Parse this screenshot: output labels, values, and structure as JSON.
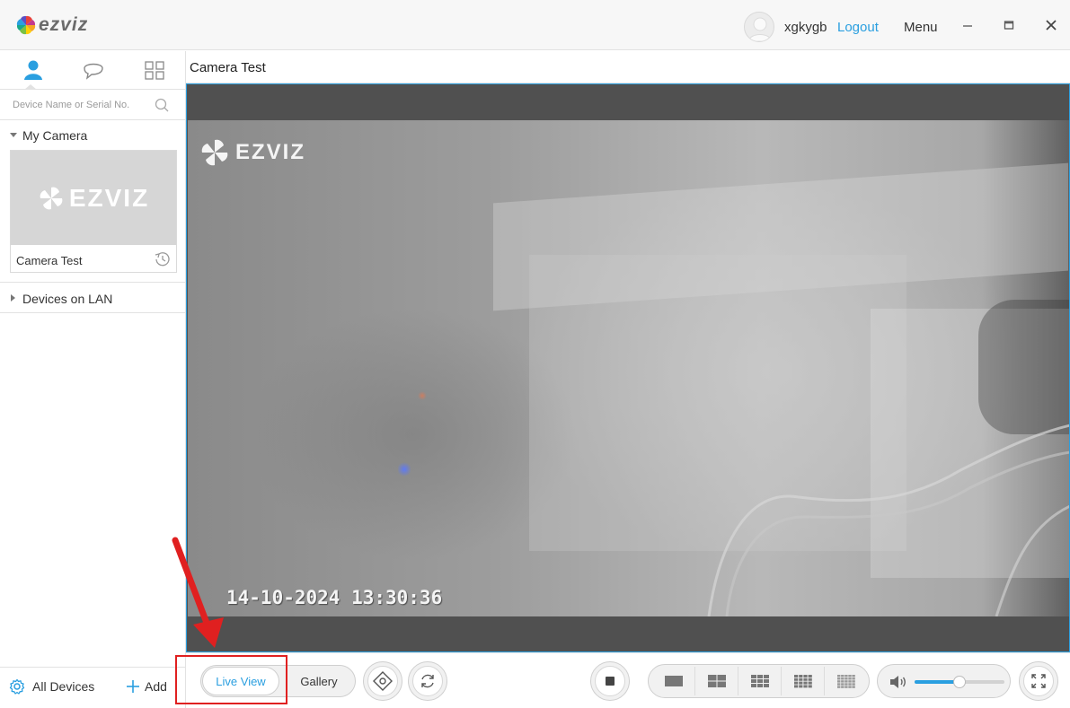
{
  "app": {
    "brand": "ezviz",
    "user": {
      "name": "xgkygb",
      "logout_label": "Logout"
    },
    "menu_label": "Menu"
  },
  "sidebar": {
    "tabs": [
      {
        "icon": "user-icon",
        "active": true
      },
      {
        "icon": "chat-icon",
        "active": false
      },
      {
        "icon": "grid-icon",
        "active": false
      }
    ],
    "search": {
      "placeholder": "Device Name or Serial No.",
      "value": ""
    },
    "groups": [
      {
        "label": "My Camera",
        "expanded": true,
        "cameras": [
          {
            "name": "Camera Test",
            "thumb_logo": "EZVIZ"
          }
        ]
      },
      {
        "label": "Devices on LAN",
        "expanded": false
      }
    ],
    "bottom": {
      "all_devices_label": "All Devices",
      "add_label": "Add"
    }
  },
  "main": {
    "title": "Camera Test",
    "video": {
      "overlay_logo": "EZVIZ",
      "timestamp": "14-10-2024 13:30:36"
    }
  },
  "toolbar": {
    "tabs": [
      {
        "label": "Live View",
        "active": true
      },
      {
        "label": "Gallery",
        "active": false
      }
    ],
    "volume": {
      "level": 0.5
    }
  },
  "colors": {
    "accent": "#2a9fe0",
    "annotation": "#e02020"
  }
}
